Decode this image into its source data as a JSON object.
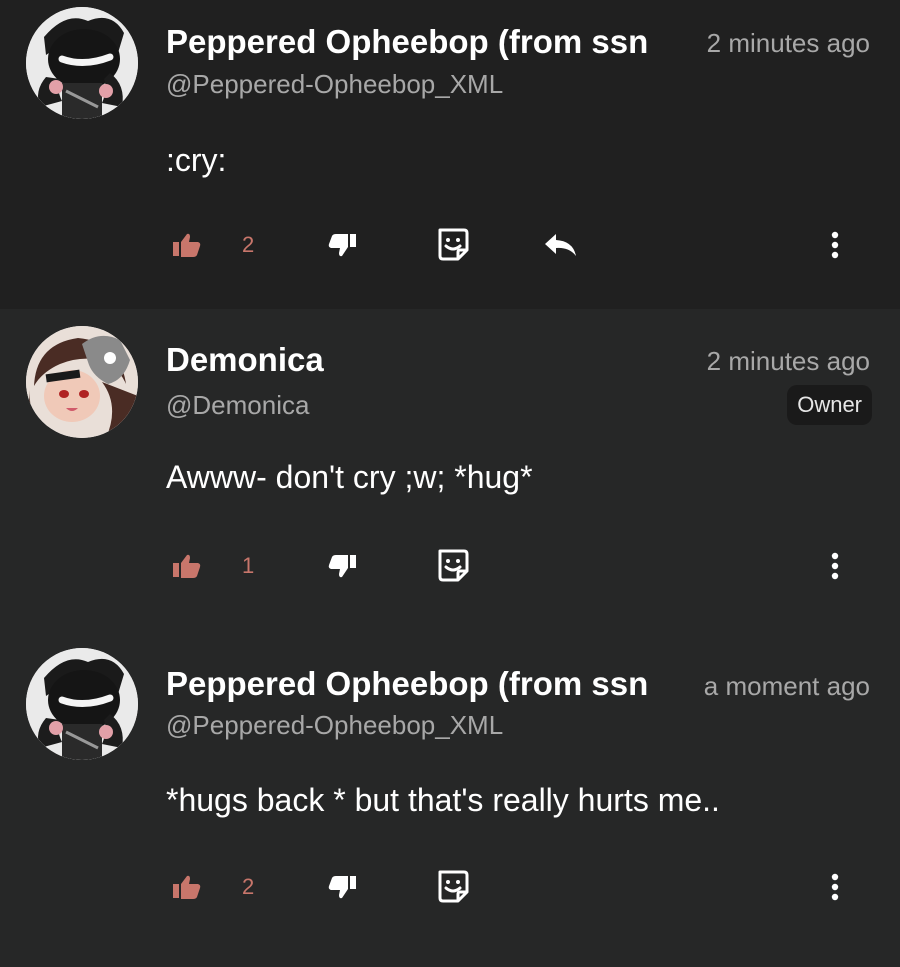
{
  "colors": {
    "like_accent": "#c8766b",
    "background": "#262727",
    "first_comment_bg": "#202020"
  },
  "comments": [
    {
      "name": "Peppered Opheebop (from ssn",
      "handle": "@Peppered-Opheebop_XML",
      "time": "2 minutes ago",
      "text": ":cry:",
      "likes": "2",
      "has_reply": true,
      "avatar": "masked-character-avatar"
    },
    {
      "name": "Demonica",
      "handle": "@Demonica",
      "time": "2 minutes ago",
      "badge": "Owner",
      "text": "Awww- don't cry ;w; *hug*",
      "likes": "1",
      "avatar": "brown-hair-character-avatar"
    },
    {
      "name": "Peppered Opheebop (from ssn",
      "handle": "@Peppered-Opheebop_XML",
      "time": "a moment ago",
      "text": "*hugs back * but that's really hurts me..",
      "likes": "2",
      "avatar": "masked-character-avatar"
    }
  ]
}
